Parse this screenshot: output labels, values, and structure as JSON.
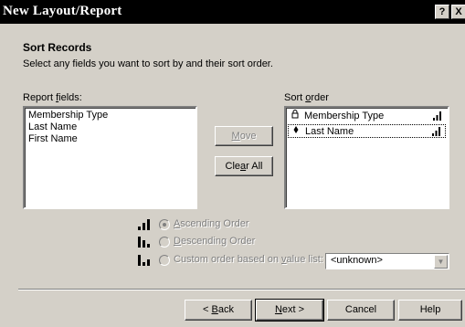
{
  "window": {
    "title": "New Layout/Report",
    "help_label": "?",
    "close_label": "X"
  },
  "header": {
    "heading": "Sort Records",
    "subheading": "Select any fields you want to sort by and their sort order."
  },
  "report_fields": {
    "label_pre": "Report ",
    "label_key": "f",
    "label_post": "ields:",
    "items": [
      "Membership Type",
      "Last Name",
      "First Name"
    ]
  },
  "sort_order": {
    "label_pre": "Sort ",
    "label_key": "o",
    "label_post": "rder",
    "items": [
      {
        "label": "Membership Type",
        "icon": "lock-icon",
        "order": "ascending"
      },
      {
        "label": "Last Name",
        "icon": "bullet-icon",
        "order": "ascending"
      }
    ]
  },
  "buttons": {
    "move_key": "M",
    "move_rest": "ove",
    "clear_pre": "Cle",
    "clear_key": "a",
    "clear_post": "r All",
    "back_pre": "< ",
    "back_key": "B",
    "back_post": "ack",
    "next_key": "N",
    "next_post": "ext >",
    "cancel": "Cancel",
    "help": "Help"
  },
  "order_options": {
    "ascending_key": "A",
    "ascending_rest": "scending Order",
    "descending_key": "D",
    "descending_rest": "escending Order",
    "custom_pre": "Custom order based on ",
    "custom_key": "v",
    "custom_post": "alue list:",
    "selected": "ascending"
  },
  "value_list": {
    "selected": "<unknown>"
  },
  "colors": {
    "dialog_bg": "#d4d0c8",
    "titlebar_bg": "#000000",
    "disabled_text": "#808080"
  }
}
